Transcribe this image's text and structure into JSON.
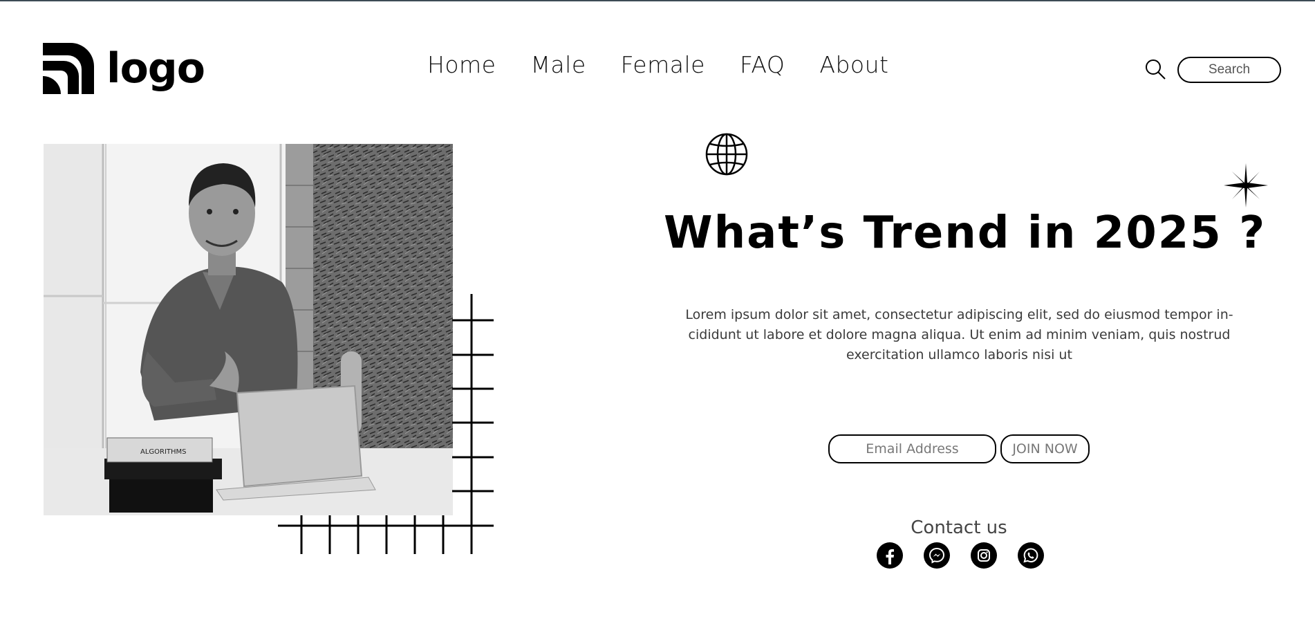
{
  "header": {
    "logo_text": "logo",
    "nav": [
      "Home",
      "Male",
      "Female",
      "FAQ",
      "About"
    ],
    "search_placeholder": "Search"
  },
  "hero": {
    "headline": "What’s Trend in 2025 ?",
    "body": "Lorem ipsum dolor sit amet, consectetur adipiscing elit, sed do eiusmod tempor in-cididunt ut labore et dolore magna aliqua. Ut enim ad minim veniam, quis nostrud exercitation ullamco laboris nisi ut",
    "email_placeholder": "Email Address",
    "join_label": "JOIN NOW",
    "contact_label": "Contact us",
    "image_book_text": "ALGORITHMS"
  },
  "socials": [
    "facebook-icon",
    "messenger-icon",
    "instagram-icon",
    "whatsapp-icon"
  ],
  "colors": {
    "accent": "#000000",
    "topline": "#3d4b55",
    "body_text": "#3a3a3a"
  }
}
